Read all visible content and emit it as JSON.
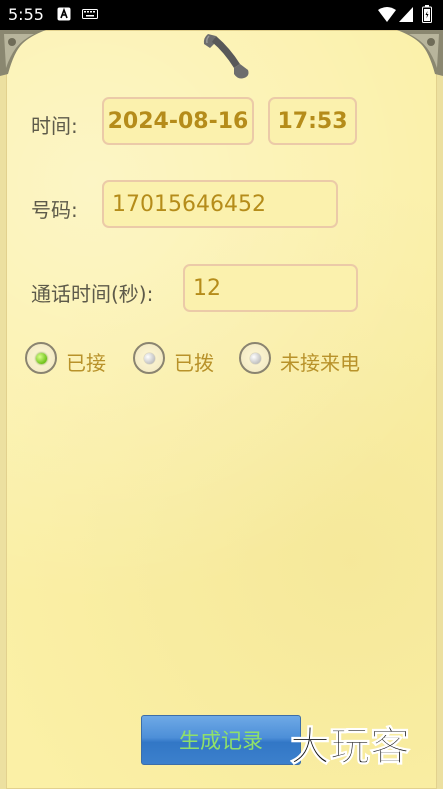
{
  "status_bar": {
    "time": "5:55",
    "left_icons": [
      "a-badge-icon",
      "keyboard-icon"
    ],
    "right_icons": [
      "wifi-icon",
      "signal-icon",
      "battery-icon"
    ]
  },
  "form": {
    "time": {
      "label": "时间:",
      "date": "2024-08-16",
      "clock": "17:53"
    },
    "number": {
      "label": "号码:",
      "value": "17015646452"
    },
    "duration": {
      "label": "通话时间(秒):",
      "value": "12"
    },
    "call_type": {
      "options": [
        {
          "label": "已接",
          "checked": true
        },
        {
          "label": "已拨",
          "checked": false
        },
        {
          "label": "未接来电",
          "checked": false
        }
      ]
    }
  },
  "actions": {
    "generate_label": "生成记录"
  },
  "watermark": {
    "text": "大玩客"
  },
  "colors": {
    "paper": "#fbf0a6",
    "field_border": "#ebcaa8",
    "field_text": "#b58c1a",
    "label_text": "#5d5a4a",
    "radio_label": "#b8922a",
    "button_blue": "#4d8fd8",
    "button_text": "#8fe06a",
    "radio_checked": "#6fc21a"
  }
}
